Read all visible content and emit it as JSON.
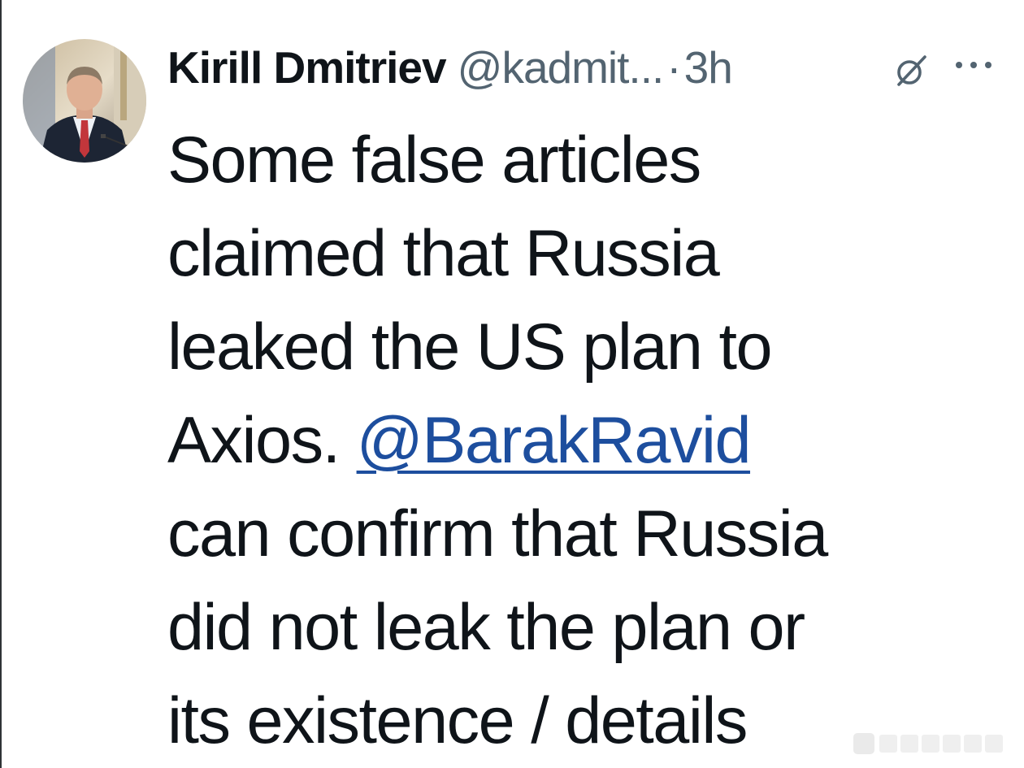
{
  "tweet": {
    "author": {
      "display_name": "Kirill Dmitriev",
      "handle": "@kadmit...",
      "separator": "·",
      "time": "3h"
    },
    "body": {
      "line1": "Some false articles",
      "line2": "claimed that Russia",
      "line3": "leaked the US plan to",
      "line4_prefix": "Axios. ",
      "mention": "@BarakRavid",
      "line5": "can confirm that Russia",
      "line6": "did not leak the plan or",
      "line7": "its existence / details"
    },
    "icons": {
      "grok": "grok-icon",
      "more": "more-options-icon"
    }
  },
  "colors": {
    "text_primary": "#0f1419",
    "text_secondary": "#536471",
    "mention": "#1d4e9e"
  }
}
